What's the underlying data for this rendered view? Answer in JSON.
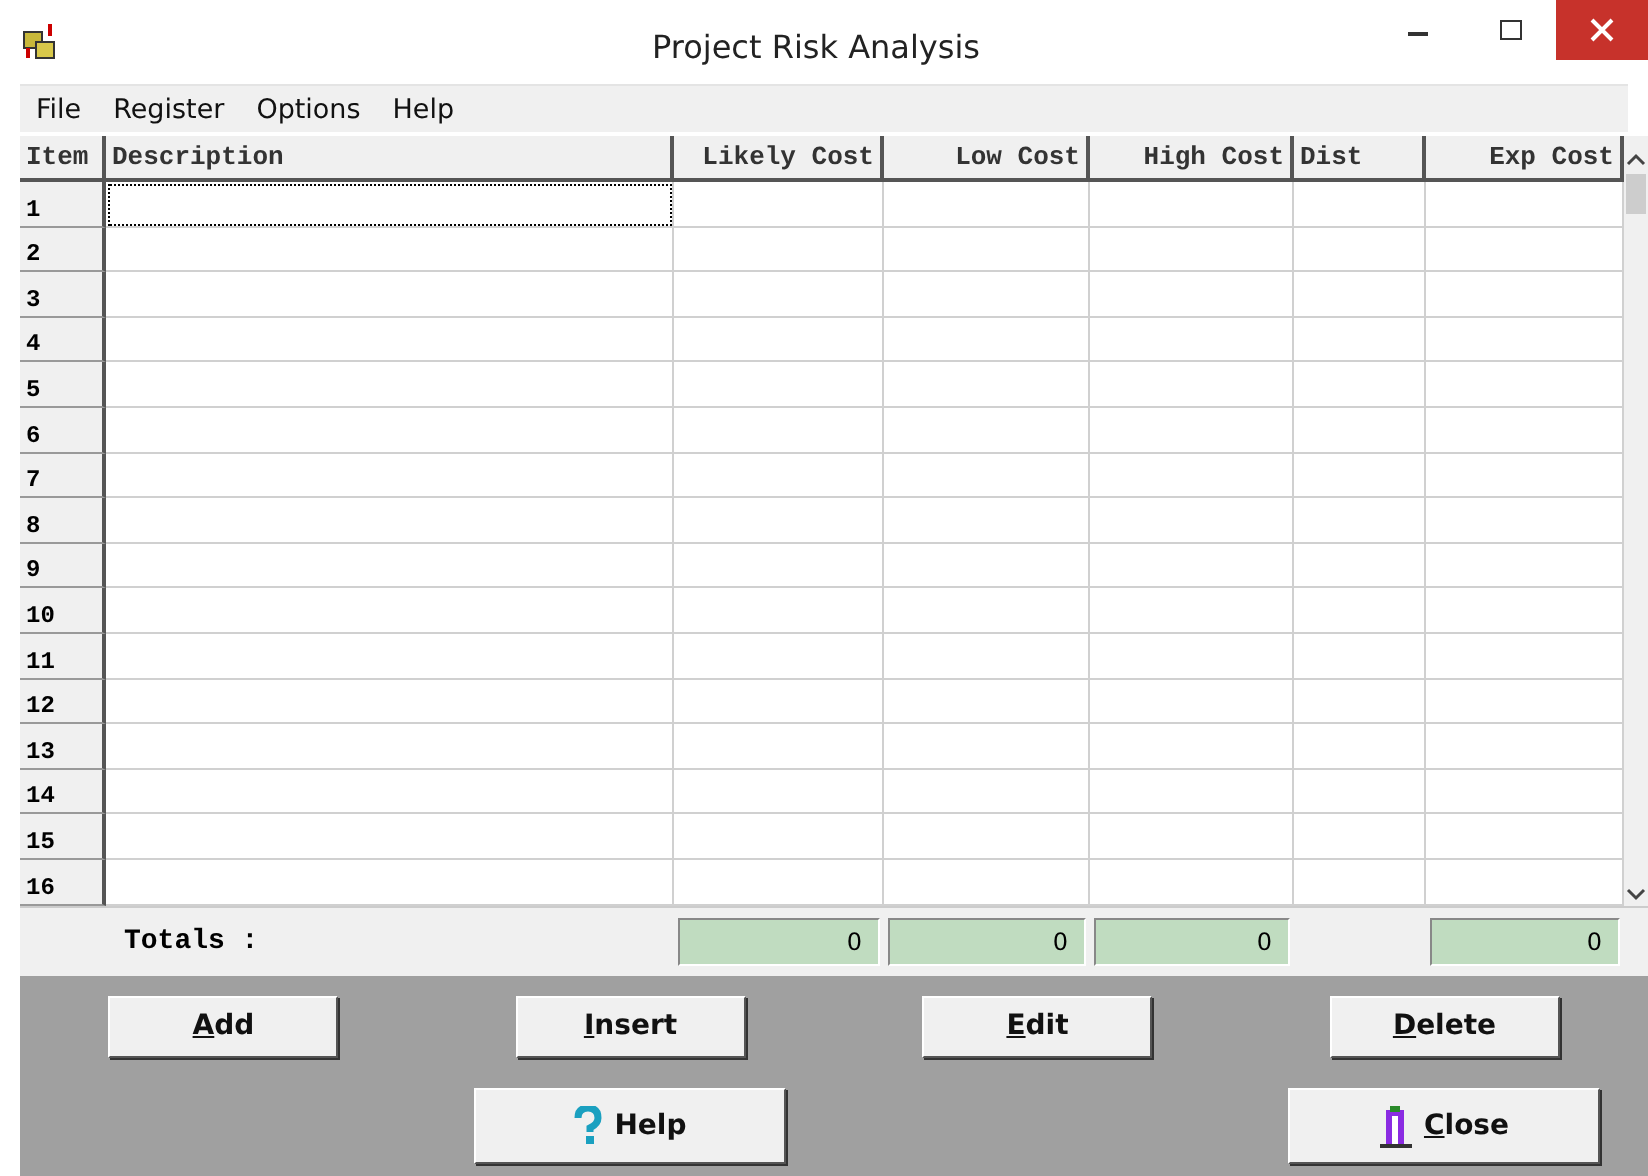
{
  "window": {
    "title": "Project Risk Analysis"
  },
  "menu": [
    "File",
    "Register",
    "Options",
    "Help"
  ],
  "table": {
    "columns": [
      "Item",
      "Description",
      "Likely Cost",
      "Low Cost",
      "High Cost",
      "Dist",
      "Exp Cost"
    ],
    "rows": [
      {
        "item": "1",
        "focused": true
      },
      {
        "item": "2",
        "focused": false
      },
      {
        "item": "3",
        "focused": false
      },
      {
        "item": "4",
        "focused": false
      },
      {
        "item": "5",
        "focused": false
      },
      {
        "item": "6",
        "focused": false
      },
      {
        "item": "7",
        "focused": false
      },
      {
        "item": "8",
        "focused": false
      },
      {
        "item": "9",
        "focused": false
      },
      {
        "item": "10",
        "focused": false
      },
      {
        "item": "11",
        "focused": false
      },
      {
        "item": "12",
        "focused": false
      },
      {
        "item": "13",
        "focused": false
      },
      {
        "item": "14",
        "focused": false
      },
      {
        "item": "15",
        "focused": false
      },
      {
        "item": "16",
        "focused": false
      }
    ]
  },
  "totals": {
    "label": "Totals :",
    "values": [
      "0",
      "0",
      "0",
      "0"
    ]
  },
  "buttons": [
    {
      "label": "Add",
      "mnemonic": true,
      "kind": "plain"
    },
    {
      "label": "Insert",
      "mnemonic": true,
      "kind": "plain"
    },
    {
      "label": "Edit",
      "mnemonic": true,
      "kind": "plain"
    },
    {
      "label": "Delete",
      "mnemonic": true,
      "kind": "plain"
    },
    {
      "label": "Help",
      "mnemonic": false,
      "kind": "help"
    },
    {
      "label": "Close",
      "mnemonic": true,
      "kind": "close"
    }
  ]
}
